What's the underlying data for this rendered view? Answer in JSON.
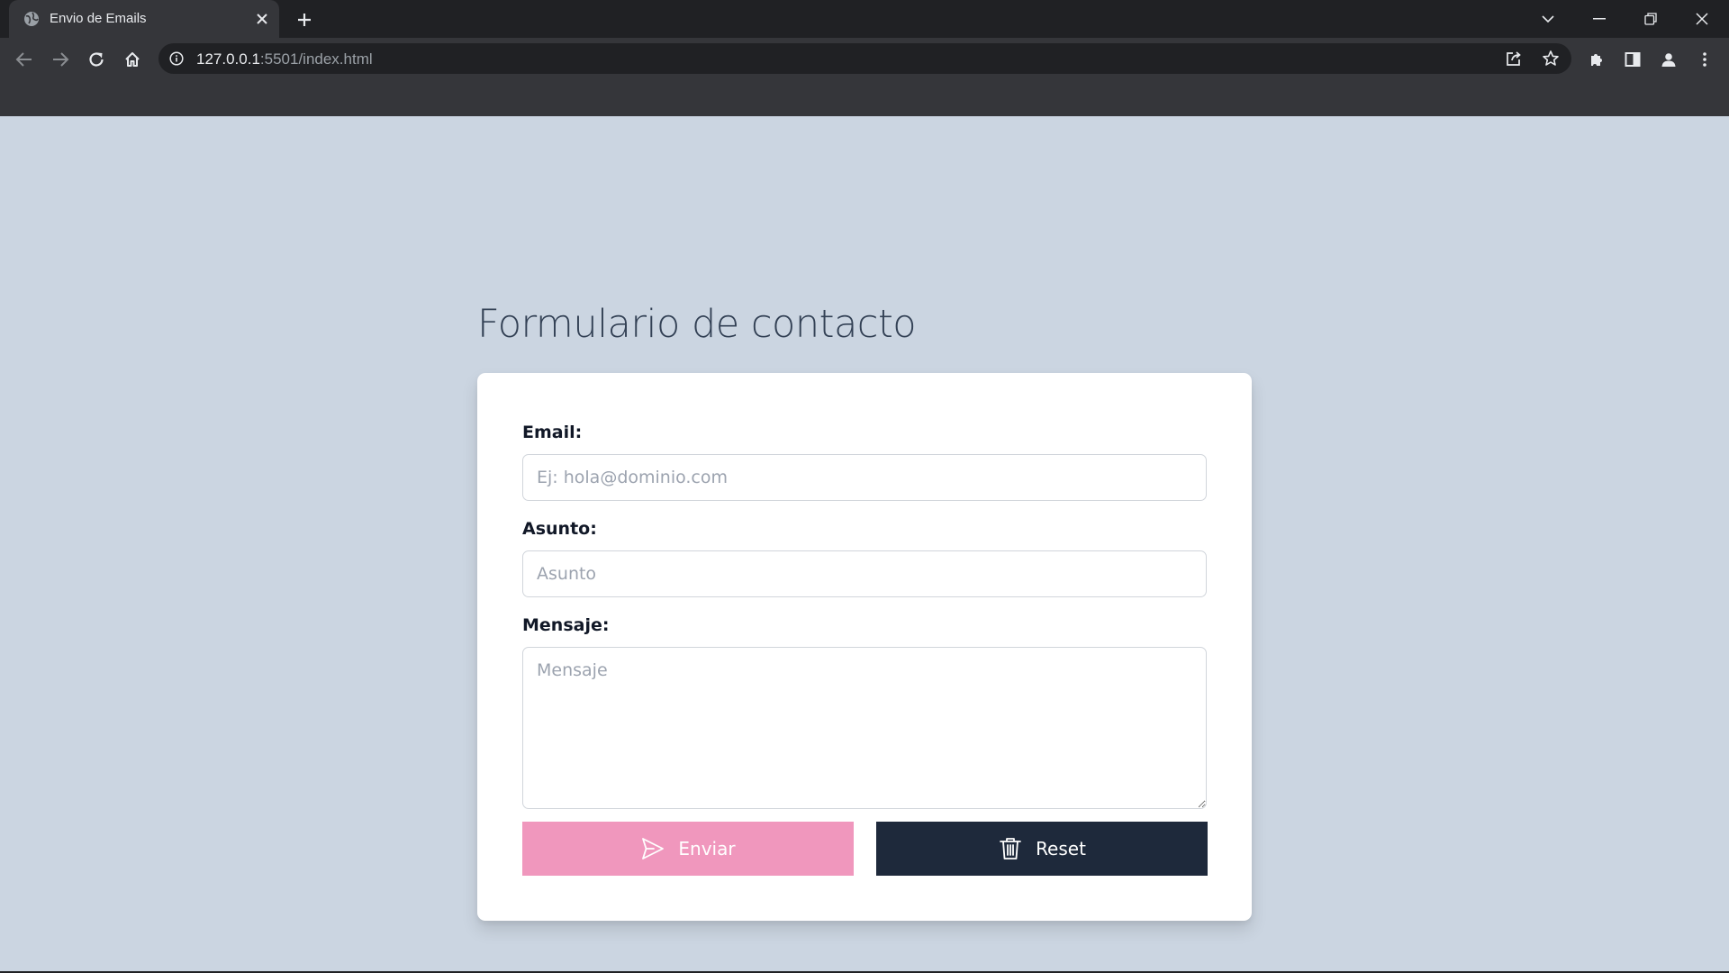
{
  "browser": {
    "tab_title": "Envio de Emails",
    "url_host": "127.0.0.1",
    "url_rest": ":5501/index.html"
  },
  "page": {
    "title": "Formulario de contacto",
    "form": {
      "email_label": "Email:",
      "email_placeholder": "Ej: hola@dominio.com",
      "subject_label": "Asunto:",
      "subject_placeholder": "Asunto",
      "message_label": "Mensaje:",
      "message_placeholder": "Mensaje",
      "send_label": "Enviar",
      "reset_label": "Reset"
    }
  },
  "colors": {
    "page_background": "#cbd5e1",
    "send_button": "#f097bd",
    "reset_button": "#1e293b"
  }
}
